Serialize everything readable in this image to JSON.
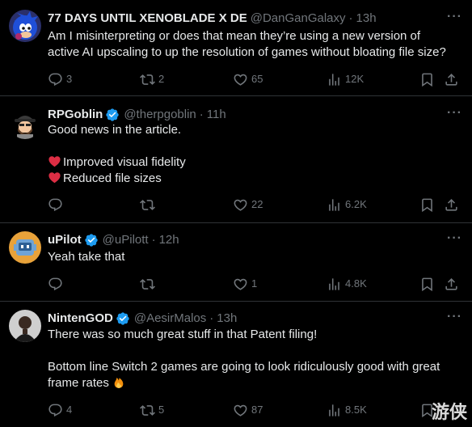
{
  "tweets": [
    {
      "name": "77 DAYS UNTIL XENOBLADE X DE",
      "handle": "@DanGanGalaxy",
      "time": "13h",
      "verified": false,
      "avatar": "sonic-avatar",
      "lines": [
        "Am I misinterpreting or does that mean they’re using a new version of",
        "active AI upscaling to up the resolution of games without bloating file size?"
      ],
      "replies": "3",
      "reposts": "2",
      "likes": "65",
      "views": "12K"
    },
    {
      "name": "RPGoblin",
      "handle": "@therpgoblin",
      "time": "11h",
      "verified": true,
      "avatar": "bearded-cap-avatar",
      "lines": [
        "Good news in the article.",
        "Improved visual fidelity",
        "Reduced file sizes"
      ],
      "replies": "",
      "reposts": "",
      "likes": "22",
      "views": "6.2K"
    },
    {
      "name": "uPilot",
      "handle": "@uPilott",
      "time": "12h",
      "verified": true,
      "avatar": "robot-avatar",
      "lines": [
        "Yeah take that"
      ],
      "replies": "",
      "reposts": "",
      "likes": "1",
      "views": "4.8K"
    },
    {
      "name": "NintenGOD",
      "handle": "@AesirMalos",
      "time": "13h",
      "verified": true,
      "avatar": "portrait-avatar",
      "lines": [
        "There was so much great stuff in that Patent filing!",
        "Bottom line Switch 2 games are going to look ridiculously good with great",
        "frame rates"
      ],
      "replies": "4",
      "reposts": "5",
      "likes": "87",
      "views": "8.5K"
    }
  ],
  "separator": "·",
  "more_label": "···",
  "watermark": "游侠",
  "colors": {
    "background": "#000000",
    "text": "#e7e9ea",
    "muted": "#71767b",
    "verified": "#1d9bf0",
    "divider": "#2f3336"
  }
}
